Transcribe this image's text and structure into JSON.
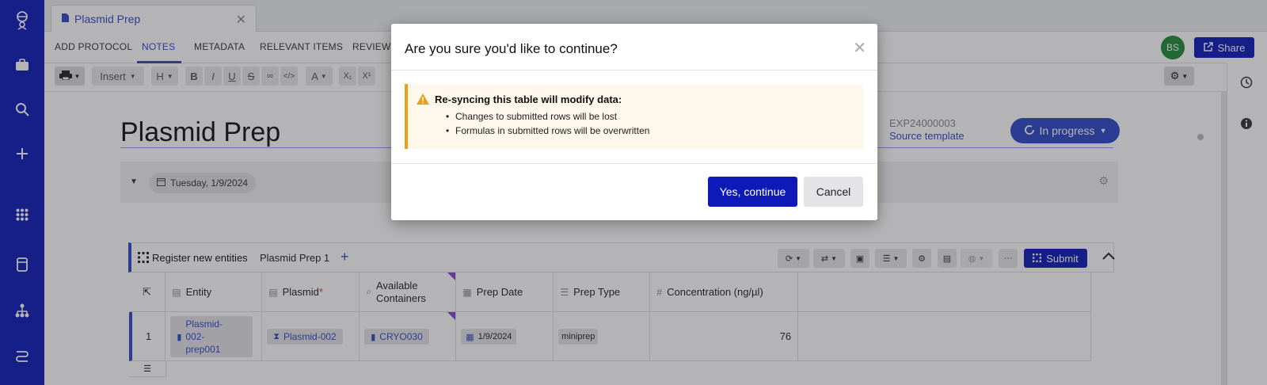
{
  "tab": {
    "label": "Plasmid Prep",
    "icon": "document-icon",
    "close": "✕"
  },
  "nav": {
    "items": [
      "ADD PROTOCOL",
      "NOTES",
      "METADATA",
      "RELEVANT ITEMS",
      "REVIEW"
    ],
    "active": "NOTES"
  },
  "user": {
    "initials": "BS"
  },
  "share": {
    "label": "Share",
    "icon": "external-share-icon"
  },
  "toolbar": {
    "insert": "Insert",
    "heading": "H"
  },
  "page": {
    "title": "Plasmid Prep",
    "exp_id": "EXP24000003",
    "source_template": "Source template",
    "status": "In progress",
    "date": "Tuesday, 1/9/2024"
  },
  "table": {
    "title": "Register new entities",
    "name": "Plasmid Prep 1",
    "submit": "Submit",
    "columns": [
      {
        "label": "Entity",
        "icon": "table-icon"
      },
      {
        "label": "Plasmid",
        "required": "*",
        "icon": "table-icon"
      },
      {
        "label": "Available Containers",
        "icon": "search-icon"
      },
      {
        "label": "Prep Date",
        "icon": "calendar-icon"
      },
      {
        "label": "Prep Type",
        "icon": "list-icon"
      },
      {
        "label": "Concentration (ng/µl)",
        "icon": "hash-icon"
      }
    ],
    "rows": [
      {
        "num": "1",
        "entity": "Plasmid-002-prep001",
        "entity_lines": [
          "Plasmid-",
          "002-",
          "prep001"
        ],
        "plasmid": "Plasmid-002",
        "container": "CRYO030",
        "prep_date": "1/9/2024",
        "prep_type": "miniprep",
        "concentration": "76"
      }
    ]
  },
  "modal": {
    "title": "Are you sure you'd like to continue?",
    "warning_title": "Re-syncing this table will modify data:",
    "warnings": [
      "Changes to submitted rows will be lost",
      "Formulas in submitted rows will be overwritten"
    ],
    "confirm": "Yes, continue",
    "cancel": "Cancel"
  },
  "colors": {
    "brand": "#0d1ab8",
    "accent": "#2f47c8",
    "warning": "#e8a21a",
    "avatar": "#1f8a3a"
  }
}
